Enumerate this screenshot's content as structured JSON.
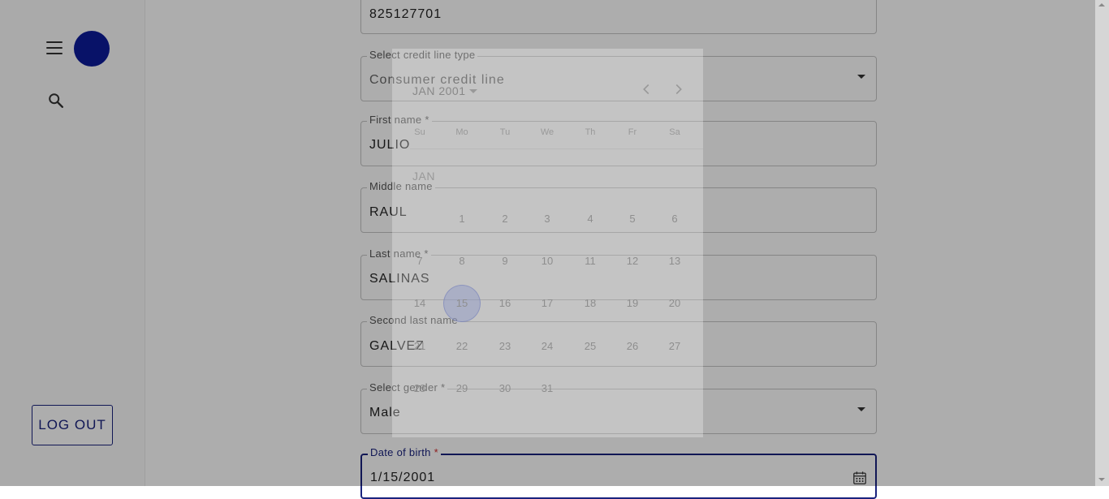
{
  "sidebar": {
    "logout_label": "LOG OUT"
  },
  "form": {
    "id_number": "825127701",
    "credit_line": {
      "label": "Select credit line type",
      "value": "Consumer credit line"
    },
    "first_name": {
      "label": "First name",
      "value": "JULIO"
    },
    "middle_name": {
      "label": "Middle name",
      "value": "RAUL"
    },
    "last_name": {
      "label": "Last name",
      "value": "SALINAS"
    },
    "second_last_name": {
      "label": "Second last name",
      "value": "GALVEZ"
    },
    "gender": {
      "label": "Select gender",
      "value": "Male"
    },
    "dob": {
      "label": "Date of birth",
      "value": "1/15/2001"
    },
    "required_marker": "*"
  },
  "datepicker": {
    "month_year": "JAN 2001",
    "month_label": "JAN",
    "weekdays": [
      "Su",
      "Mo",
      "Tu",
      "We",
      "Th",
      "Fr",
      "Sa"
    ],
    "weeks": [
      [
        "",
        "1",
        "2",
        "3",
        "4",
        "5",
        "6"
      ],
      [
        "7",
        "8",
        "9",
        "10",
        "11",
        "12",
        "13"
      ],
      [
        "14",
        "15",
        "16",
        "17",
        "18",
        "19",
        "20"
      ],
      [
        "21",
        "22",
        "23",
        "24",
        "25",
        "26",
        "27"
      ],
      [
        "28",
        "29",
        "30",
        "31",
        "",
        "",
        ""
      ]
    ],
    "selected_day": "15"
  },
  "icons": {
    "menu": "menu-icon",
    "search": "search-icon",
    "calendar": "calendar-icon",
    "prev": "chevron-left-icon",
    "next": "chevron-right-icon",
    "dropdown": "arrow-drop-down-icon"
  },
  "colors": {
    "primary": "#1a237e",
    "avatar": "#0d1b9a",
    "required": "#d32f2f"
  }
}
